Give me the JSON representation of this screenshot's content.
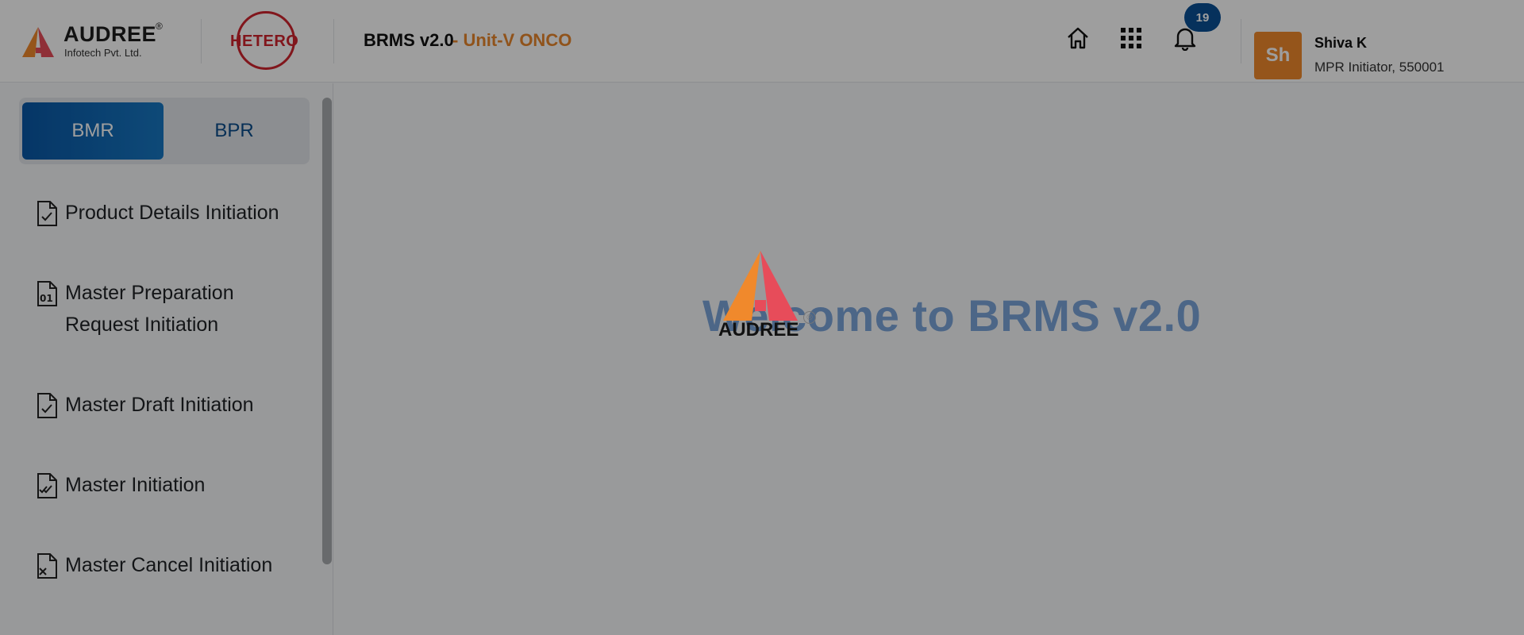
{
  "header": {
    "brand_name": "AUDREE",
    "brand_reg": "®",
    "brand_sub": "Infotech Pvt. Ltd.",
    "partner_name": "HETERO",
    "app_title": "BRMS v2.0",
    "app_unit": " - Unit-V ONCO",
    "notification_count": "19",
    "user": {
      "initials": "Sh",
      "name": "Shiva K",
      "role": "MPR Initiator, 550001"
    },
    "icons": [
      "home-icon",
      "apps-grid-icon",
      "bell-icon"
    ]
  },
  "sidebar": {
    "toggle": {
      "active": "BMR",
      "inactive": "BPR"
    },
    "items": [
      {
        "label": "Product Details Initiation",
        "icon": "file-check-icon"
      },
      {
        "label": "Master Preparation\nRequest Initiation",
        "icon": "file-binary-icon"
      },
      {
        "label": "Master Draft Initiation",
        "icon": "file-check-icon"
      },
      {
        "label": "Master Initiation",
        "icon": "file-double-check-icon"
      },
      {
        "label": "Master Cancel Initiation",
        "icon": "file-x-icon"
      }
    ]
  },
  "main": {
    "welcome": "Welcome to BRMS v2.0",
    "loader_word": "AUDREE",
    "loader_reg": "®"
  },
  "colors": {
    "accent_blue": "#0a58a6",
    "brand_orange": "#e8872c",
    "hetero_red": "#d0242e",
    "welcome_blue": "#7ba5da"
  }
}
